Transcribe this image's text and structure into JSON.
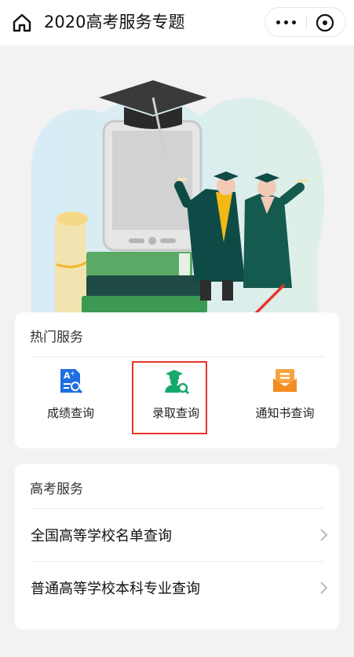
{
  "header": {
    "title": "2020高考服务专题",
    "icons": {
      "home": "home-icon",
      "more": "more-icon",
      "close": "close-circle-icon"
    }
  },
  "hot_services": {
    "title": "热门服务",
    "items": [
      {
        "label": "成绩查询",
        "icon": "score-search-icon",
        "color": "#1f6fe0"
      },
      {
        "label": "录取查询",
        "icon": "admission-search-icon",
        "color": "#17a86b"
      },
      {
        "label": "通知书查询",
        "icon": "letter-icon",
        "color": "#f28b22"
      }
    ]
  },
  "gaokao_services": {
    "title": "高考服务",
    "items": [
      {
        "label": "全国高等学校名单查询"
      },
      {
        "label": "普通高等学校本科专业查询"
      }
    ]
  },
  "colors": {
    "highlight": "#e8352b",
    "background": "#f2f2f2"
  }
}
